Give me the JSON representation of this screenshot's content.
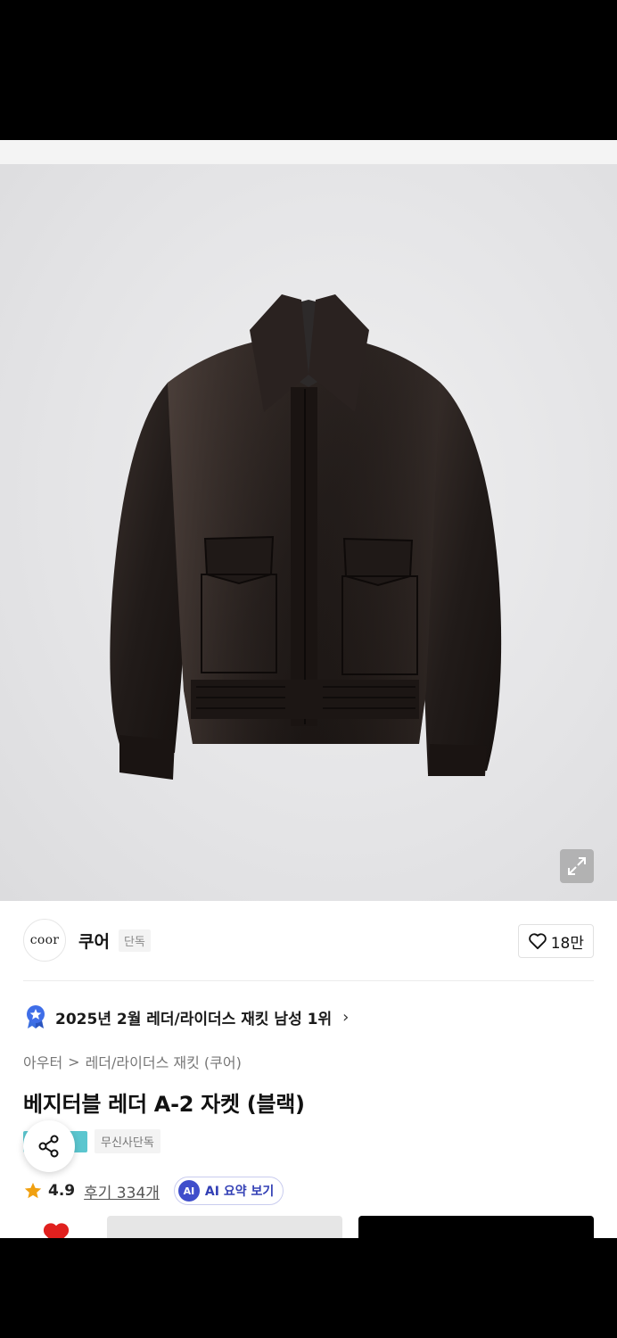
{
  "brand": {
    "logo_text": "coor",
    "name": "쿠어",
    "tag": "단독"
  },
  "like": {
    "count": "18만"
  },
  "ranking": {
    "text": "2025년 2월 레더/라이더스 재킷 남성 1위",
    "chevron": "›"
  },
  "breadcrumb": {
    "items": [
      "아우터",
      "레더/라이더스 재킷 (쿠어)"
    ],
    "separator": ">"
  },
  "product": {
    "title": "베지터블 레더 A-2 자켓 (블랙)"
  },
  "badges": {
    "exclusive": "무신사단독"
  },
  "rating": {
    "score": "4.9",
    "reviews": "후기 334개"
  },
  "ai_summary": {
    "icon_text": "AI",
    "label": "AI 요약 보기"
  },
  "colors": {
    "accent": "#3f4ecb",
    "heart": "#e0201e",
    "star": "#f0a010",
    "badge_teal": "#5bc6cf"
  },
  "icons": {
    "expand": "expand-icon",
    "heart_outline": "heart-outline-icon",
    "ranking": "ranking-medal-icon",
    "share": "share-icon",
    "star": "star-icon",
    "heart_filled": "heart-filled-icon"
  }
}
